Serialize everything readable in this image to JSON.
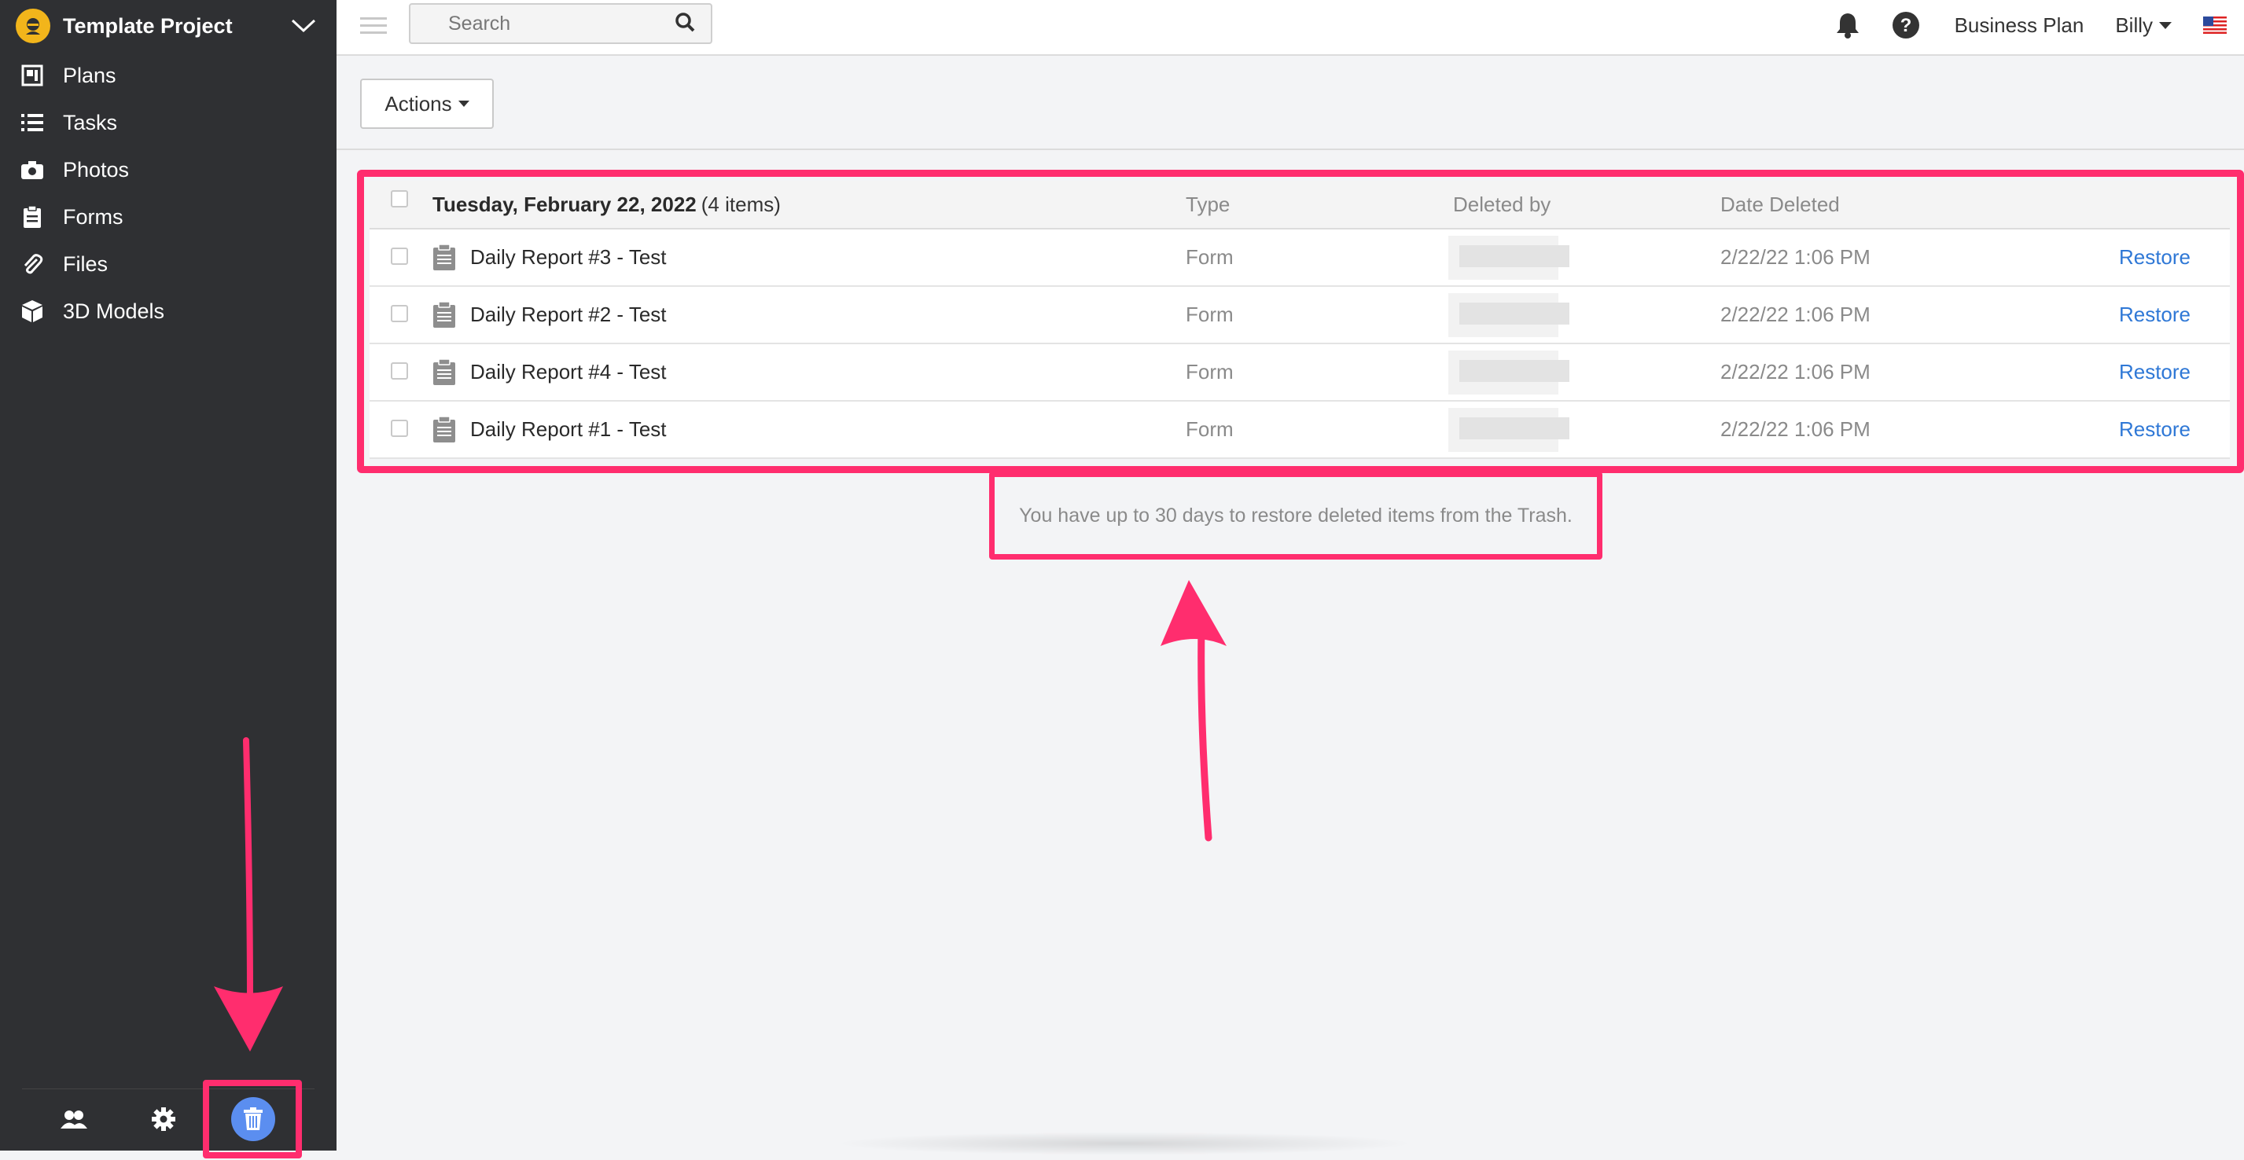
{
  "sidebar": {
    "project_title": "Template Project",
    "items": [
      {
        "label": "Plans",
        "icon": "plans-icon"
      },
      {
        "label": "Tasks",
        "icon": "list-icon"
      },
      {
        "label": "Photos",
        "icon": "camera-icon"
      },
      {
        "label": "Forms",
        "icon": "clipboard-icon"
      },
      {
        "label": "Files",
        "icon": "paperclip-icon"
      },
      {
        "label": "3D Models",
        "icon": "cube-icon"
      }
    ],
    "footer_icons": [
      "users-icon",
      "gear-icon",
      "trash-icon"
    ]
  },
  "topbar": {
    "search_placeholder": "Search",
    "plan_label": "Business Plan",
    "user_label": "Billy"
  },
  "actions": {
    "label": "Actions"
  },
  "table": {
    "group_date": "Tuesday, February 22, 2022",
    "group_count": "(4 items)",
    "columns": {
      "type": "Type",
      "deleted_by": "Deleted by",
      "date_deleted": "Date Deleted"
    },
    "rows": [
      {
        "name": "Daily Report #3 - Test",
        "type": "Form",
        "date": "2/22/22 1:06 PM",
        "action": "Restore"
      },
      {
        "name": "Daily Report #2 - Test",
        "type": "Form",
        "date": "2/22/22 1:06 PM",
        "action": "Restore"
      },
      {
        "name": "Daily Report #4 - Test",
        "type": "Form",
        "date": "2/22/22 1:06 PM",
        "action": "Restore"
      },
      {
        "name": "Daily Report #1 - Test",
        "type": "Form",
        "date": "2/22/22 1:06 PM",
        "action": "Restore"
      }
    ]
  },
  "notice": "You have up to 30 days to restore deleted items from the Trash.",
  "colors": {
    "accent": "#ff2d6e",
    "link": "#2f78d6",
    "sidebar": "#2f3033",
    "trash_button": "#5b8ef0"
  }
}
